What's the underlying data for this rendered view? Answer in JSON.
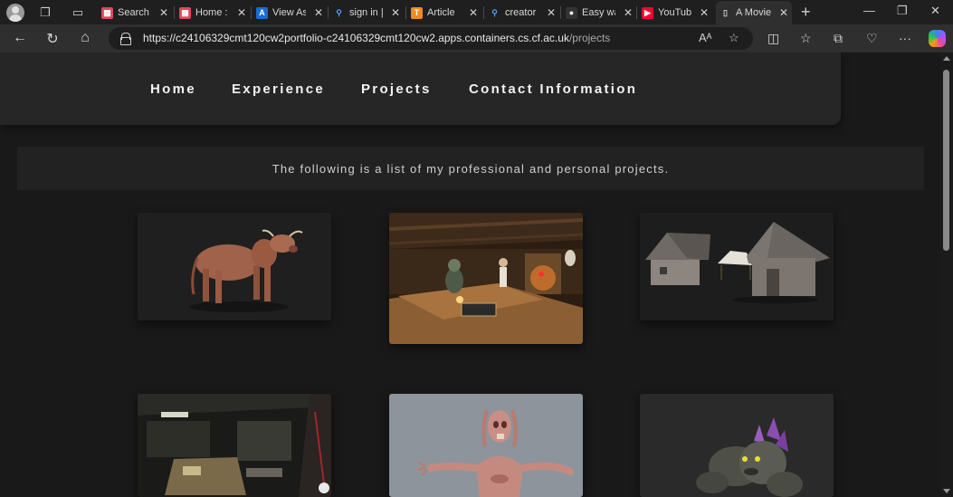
{
  "browser": {
    "tabs": [
      {
        "title": "Search",
        "favicon": "red-grid-icon",
        "color": "#e0475a"
      },
      {
        "title": "Home :",
        "favicon": "red-grid-icon",
        "color": "#e0475a"
      },
      {
        "title": "View As",
        "favicon": "a-logo-icon",
        "color": "#1b6dd1"
      },
      {
        "title": "sign in |",
        "favicon": "search-icon",
        "color": "#4ea3ff"
      },
      {
        "title": "Article",
        "favicon": "t-logo-icon",
        "color": "#f08a24"
      },
      {
        "title": "creator",
        "favicon": "search-icon",
        "color": "#4ea3ff"
      },
      {
        "title": "Easy wa",
        "favicon": "dark-circle-icon",
        "color": "#333333"
      },
      {
        "title": "YouTube",
        "favicon": "youtube-icon",
        "color": "#ff0033"
      },
      {
        "title": "A Movie",
        "favicon": "document-icon",
        "color": "#cfcfcf",
        "active": true
      }
    ],
    "url_main": "https://c24106329cmt120cw2portfolio-c24106329cmt120cw2.apps.containers.cs.cf.ac.uk",
    "url_path": "/projects"
  },
  "nav": {
    "home": "Home",
    "experience": "Experience",
    "projects": "Projects",
    "contact": "Contact Information"
  },
  "intro_text": "The following is a list of my professional and personal projects.",
  "projects": [
    {
      "image": "cow-model"
    },
    {
      "image": "tavern-interior"
    },
    {
      "image": "wooden-houses"
    },
    {
      "image": "dark-office-scene"
    },
    {
      "image": "zombie-character"
    },
    {
      "image": "rock-creature"
    }
  ],
  "colors": {
    "page_bg": "#191919",
    "navbar_bg": "#262626",
    "intro_bg": "#222222"
  }
}
